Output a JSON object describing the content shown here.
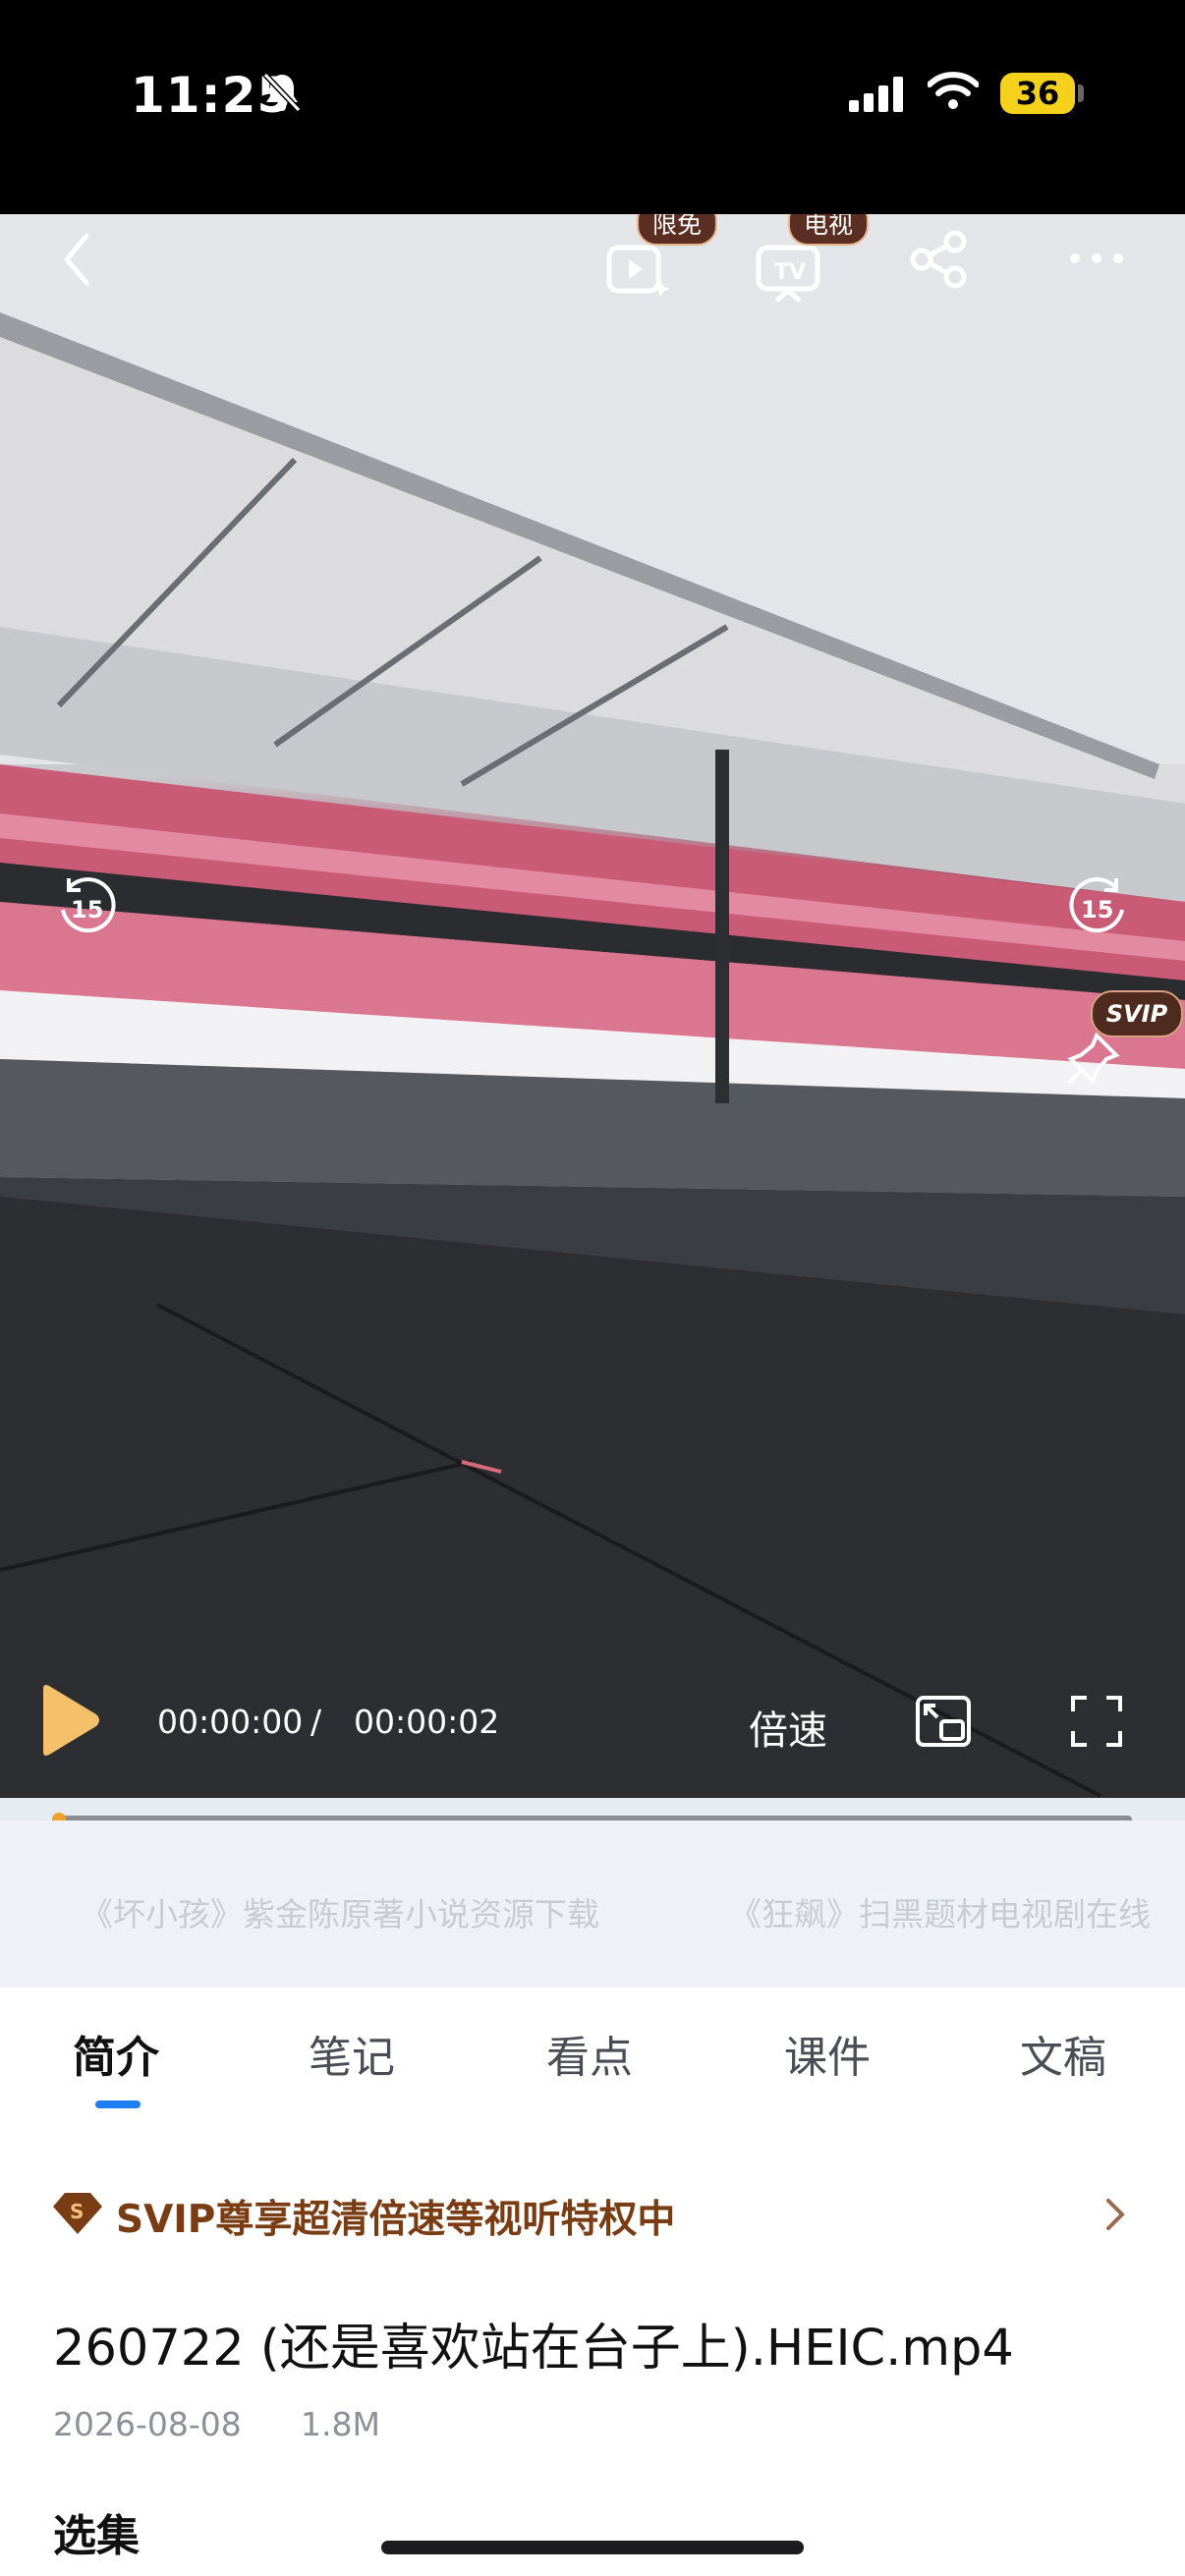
{
  "status_bar": {
    "time": "11:25",
    "battery": "36"
  },
  "video": {
    "badges": {
      "free": "限免",
      "tv": "电视",
      "svip": "SVIP"
    },
    "controls": {
      "current_time": "00:00:00",
      "separator": "/",
      "total_time": "00:00:02",
      "speed_label": "倍速",
      "skip_seconds": "15"
    },
    "progress": 0.0
  },
  "recommendations": [
    "《坏小孩》紫金陈原著小说资源下载",
    "《狂飙》扫黑题材电视剧在线"
  ],
  "tabs": [
    "简介",
    "笔记",
    "看点",
    "课件",
    "文稿"
  ],
  "svip_banner": {
    "text": "SVIP尊享超清倍速等视听特权中"
  },
  "file": {
    "name": "260722 (还是喜欢站在台子上).HEIC.mp4",
    "date": "2026-08-08",
    "size": "1.8M"
  },
  "episodes_title": "选集",
  "colors": {
    "accent": "#1f7ff2",
    "svip_brown": "#7a3c12",
    "progress_dot": "#f0a22d"
  }
}
